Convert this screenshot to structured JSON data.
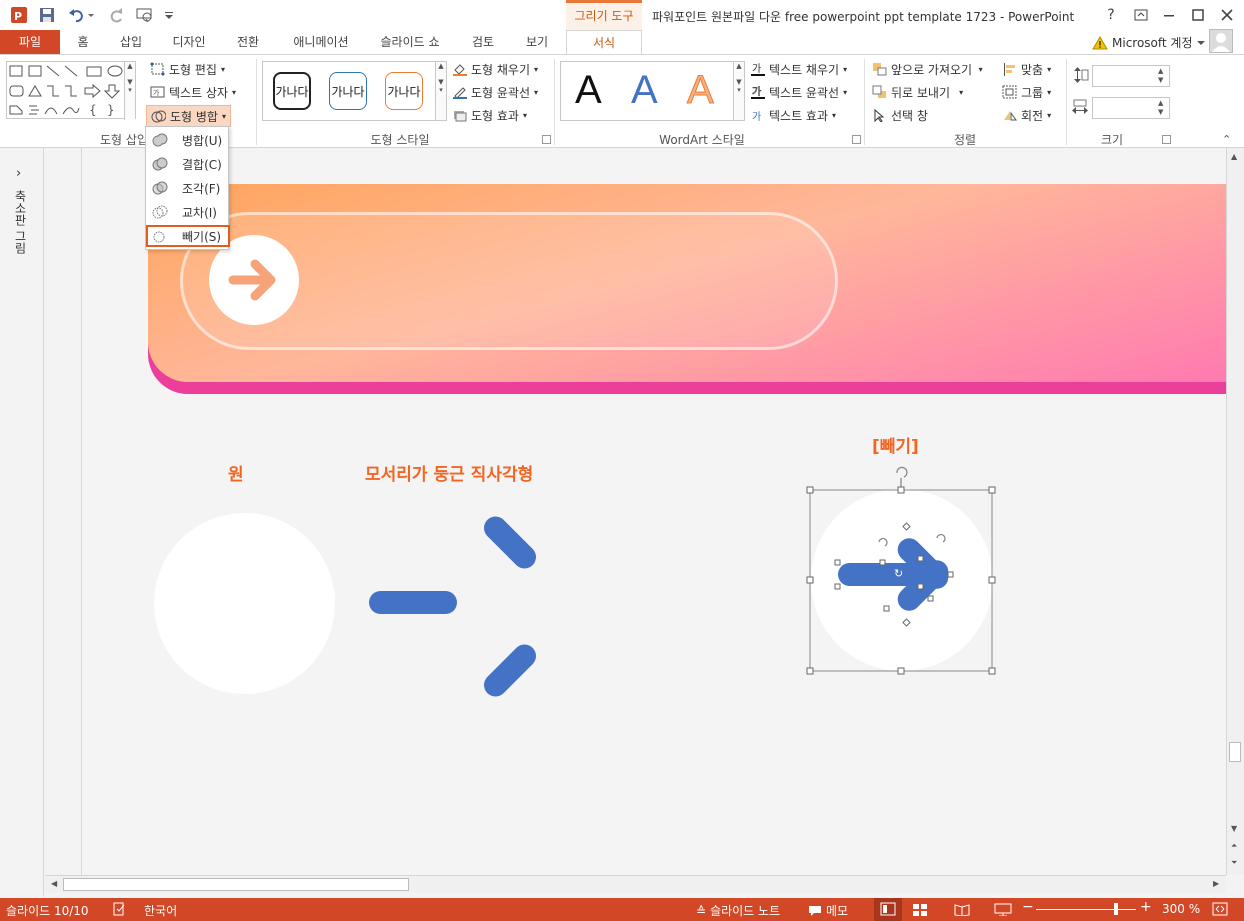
{
  "app": {
    "title": "파워포인트 원본파일 다운 free powerpoint ppt template 1723 - PowerPoint",
    "context_group": "그리기 도구",
    "account": "Microsoft 계정",
    "accent": "#d24726"
  },
  "window_controls": {
    "help": "?",
    "restore_ribbon": "⊡",
    "minimize": "—",
    "maximize": "☐",
    "close": "✕"
  },
  "tabs": [
    "파일",
    "홈",
    "삽입",
    "디자인",
    "전환",
    "애니메이션",
    "슬라이드 쇼",
    "검토",
    "보기",
    "서식"
  ],
  "ribbon": {
    "insert_shapes": {
      "label": "도형 삽입",
      "edit_shape": "도형 편집",
      "text_box": "텍스트 상자",
      "merge_shapes": "도형 병합"
    },
    "shape_styles": {
      "label": "도형 스타일",
      "sample_text": "가나다",
      "fill": "도형 채우기",
      "outline": "도형 윤곽선",
      "effects": "도형 효과"
    },
    "wordart": {
      "label": "WordArt 스타일",
      "sample": "A",
      "text_fill": "텍스트 채우기",
      "text_outline": "텍스트 윤곽선",
      "text_effects": "텍스트 효과"
    },
    "arrange": {
      "label": "정렬",
      "bring_forward": "앞으로 가져오기",
      "send_backward": "뒤로 보내기",
      "selection_pane": "선택 창",
      "align": "맞춤",
      "group": "그룹",
      "rotate": "회전"
    },
    "size": {
      "label": "크기",
      "height": "",
      "width": ""
    }
  },
  "merge_menu": [
    {
      "label": "병합(U)"
    },
    {
      "label": "결합(C)"
    },
    {
      "label": "조각(F)"
    },
    {
      "label": "교차(I)"
    },
    {
      "label": "빼기(S)"
    }
  ],
  "left_pane": {
    "label": "축소판 그림",
    "toggle": "›"
  },
  "slide": {
    "caption_circle": "원",
    "caption_rect": "모서리가 둥근 직사각형",
    "caption_subtract": "[빼기]",
    "banner_colors": [
      "#ffa45c",
      "#ff7ab0",
      "#ec3f9c"
    ],
    "shape_color": "#4472c4",
    "caption_color": "#f26522"
  },
  "status": {
    "slide": "슬라이드 10/10",
    "language": "한국어",
    "notes": "슬라이드 노트",
    "comments": "메모",
    "zoom": "300 %"
  }
}
